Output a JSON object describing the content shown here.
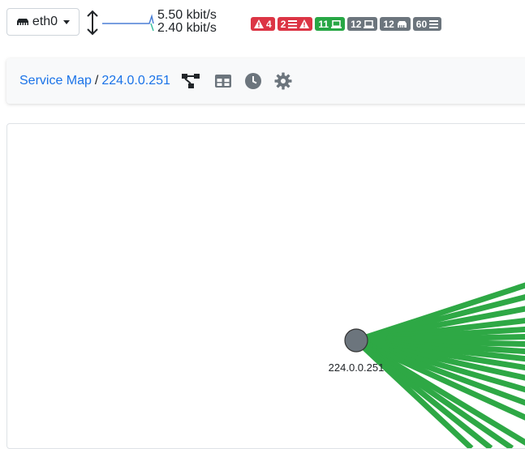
{
  "interface": {
    "name": "eth0"
  },
  "traffic": {
    "upload": "5.50 kbit/s",
    "download": "2.40 kbit/s"
  },
  "badges": [
    {
      "count": "4",
      "icon": "warning-icon",
      "color": "#dc3545"
    },
    {
      "count": "2",
      "icon": "list-warning-icon",
      "color": "#dc3545"
    },
    {
      "count": "11",
      "icon": "laptop-icon",
      "color": "#28a745"
    },
    {
      "count": "12",
      "icon": "laptop-icon",
      "color": "#6c757d"
    },
    {
      "count": "12",
      "icon": "network-card-icon",
      "color": "#6c757d"
    },
    {
      "count": "60",
      "icon": "flows-icon",
      "color": "#6c757d"
    }
  ],
  "breadcrumb": {
    "root": "Service Map",
    "separator": "/",
    "current": "224.0.0.251"
  },
  "toolbar": {
    "icons": [
      "service-map-icon",
      "table-icon",
      "clock-icon",
      "gear-icon"
    ]
  },
  "map": {
    "node_label": "224.0.0.251",
    "edge_color": "#2ea845",
    "node_color": "#6c757d"
  }
}
